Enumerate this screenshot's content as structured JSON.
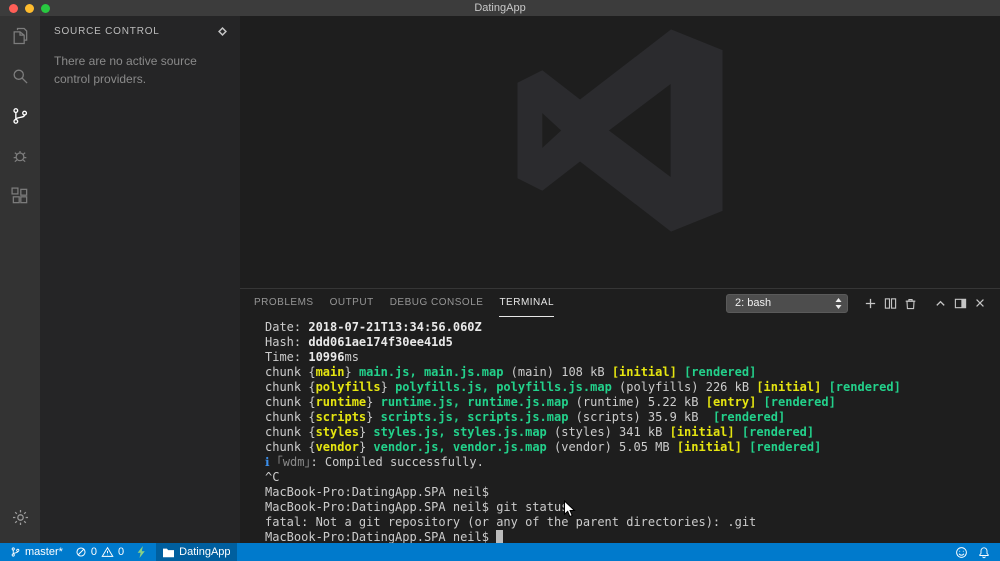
{
  "colors": {
    "statusbar": "#007acc",
    "terminal_yellow": "#e5e510",
    "terminal_green": "#23d18b",
    "terminal_blue": "#3b8eea",
    "traffic_red": "#ff5f57",
    "traffic_yellow": "#febc2e",
    "traffic_green": "#28c840"
  },
  "titlebar": {
    "title": "DatingApp"
  },
  "activity_bar": {
    "items": [
      "explorer",
      "search",
      "source-control",
      "debug",
      "extensions"
    ],
    "active_item": "source-control",
    "bottom": "settings"
  },
  "sidebar": {
    "title": "SOURCE CONTROL",
    "header_icon": "source-control-providers-icon",
    "empty_message": "There are no active source control providers."
  },
  "panel": {
    "tabs": [
      "PROBLEMS",
      "OUTPUT",
      "DEBUG CONSOLE",
      "TERMINAL"
    ],
    "active_tab": "TERMINAL",
    "terminal_picker": "2: bash",
    "actions": [
      "new-terminal",
      "split-terminal",
      "kill-terminal",
      "maximize-panel",
      "panel-layout",
      "close-panel"
    ]
  },
  "terminal": {
    "lines": [
      [
        {
          "c": "w",
          "t": "Date: "
        },
        {
          "c": "b",
          "t": "2018-07-21T13:34:56.060Z"
        }
      ],
      [
        {
          "c": "w",
          "t": "Hash: "
        },
        {
          "c": "b",
          "t": "ddd061ae174f30ee41d5"
        }
      ],
      [
        {
          "c": "w",
          "t": "Time: "
        },
        {
          "c": "b",
          "t": "10996"
        },
        {
          "c": "w",
          "t": "ms"
        }
      ],
      [
        {
          "c": "w",
          "t": "chunk {"
        },
        {
          "c": "y",
          "t": "main"
        },
        {
          "c": "w",
          "t": "} "
        },
        {
          "c": "g",
          "t": "main.js, main.js.map"
        },
        {
          "c": "w",
          "t": " (main) 108 kB "
        },
        {
          "c": "y",
          "t": "[initial]"
        },
        {
          "c": "w",
          "t": " "
        },
        {
          "c": "g",
          "t": "[rendered]"
        }
      ],
      [
        {
          "c": "w",
          "t": "chunk {"
        },
        {
          "c": "y",
          "t": "polyfills"
        },
        {
          "c": "w",
          "t": "} "
        },
        {
          "c": "g",
          "t": "polyfills.js, polyfills.js.map"
        },
        {
          "c": "w",
          "t": " (polyfills) 226 kB "
        },
        {
          "c": "y",
          "t": "[initial]"
        },
        {
          "c": "w",
          "t": " "
        },
        {
          "c": "g",
          "t": "[rendered]"
        }
      ],
      [
        {
          "c": "w",
          "t": "chunk {"
        },
        {
          "c": "y",
          "t": "runtime"
        },
        {
          "c": "w",
          "t": "} "
        },
        {
          "c": "g",
          "t": "runtime.js, runtime.js.map"
        },
        {
          "c": "w",
          "t": " (runtime) 5.22 kB "
        },
        {
          "c": "y",
          "t": "[entry]"
        },
        {
          "c": "w",
          "t": " "
        },
        {
          "c": "g",
          "t": "[rendered]"
        }
      ],
      [
        {
          "c": "w",
          "t": "chunk {"
        },
        {
          "c": "y",
          "t": "scripts"
        },
        {
          "c": "w",
          "t": "} "
        },
        {
          "c": "g",
          "t": "scripts.js, scripts.js.map"
        },
        {
          "c": "w",
          "t": " (scripts) 35.9 kB  "
        },
        {
          "c": "g",
          "t": "[rendered]"
        }
      ],
      [
        {
          "c": "w",
          "t": "chunk {"
        },
        {
          "c": "y",
          "t": "styles"
        },
        {
          "c": "w",
          "t": "} "
        },
        {
          "c": "g",
          "t": "styles.js, styles.js.map"
        },
        {
          "c": "w",
          "t": " (styles) 341 kB "
        },
        {
          "c": "y",
          "t": "[initial]"
        },
        {
          "c": "w",
          "t": " "
        },
        {
          "c": "g",
          "t": "[rendered]"
        }
      ],
      [
        {
          "c": "w",
          "t": "chunk {"
        },
        {
          "c": "y",
          "t": "vendor"
        },
        {
          "c": "w",
          "t": "} "
        },
        {
          "c": "g",
          "t": "vendor.js, vendor.js.map"
        },
        {
          "c": "w",
          "t": " (vendor) 5.05 MB "
        },
        {
          "c": "y",
          "t": "[initial]"
        },
        {
          "c": "w",
          "t": " "
        },
        {
          "c": "g",
          "t": "[rendered]"
        }
      ],
      [
        {
          "c": "blue",
          "t": "ℹ"
        },
        {
          "c": "gray",
          "t": " ｢wdm｣"
        },
        {
          "c": "w",
          "t": ": Compiled successfully."
        }
      ],
      [
        {
          "c": "w",
          "t": "^C"
        }
      ],
      [
        {
          "c": "w",
          "t": "MacBook-Pro:DatingApp.SPA neil$"
        }
      ],
      [
        {
          "c": "w",
          "t": "MacBook-Pro:DatingApp.SPA neil$ git status"
        }
      ],
      [
        {
          "c": "w",
          "t": "fatal: Not a git repository (or any of the parent directories): .git"
        }
      ],
      [
        {
          "c": "w",
          "t": "MacBook-Pro:DatingApp.SPA neil$ "
        },
        {
          "c": "cur",
          "t": " "
        }
      ]
    ]
  },
  "status_bar": {
    "branch": "master*",
    "errors": "0",
    "warnings": "0",
    "folder": "DatingApp",
    "right_icons": [
      "feedback-smiley",
      "notifications-bell"
    ]
  }
}
